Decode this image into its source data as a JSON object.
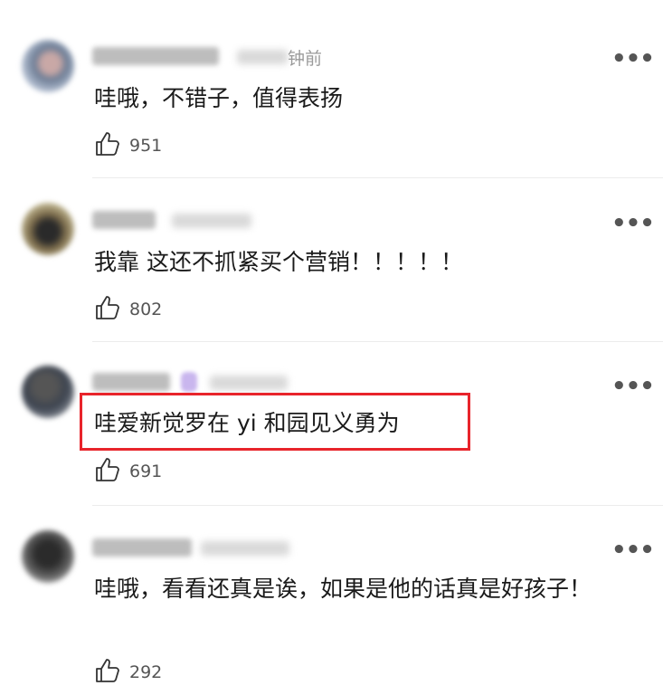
{
  "comments": [
    {
      "time_suffix": "钟前",
      "text": "哇哦，不错子，值得表扬",
      "like_count": "951",
      "more_label": "•••"
    },
    {
      "text": "我靠 这还不抓紧买个营销！！！！！",
      "like_count": "802",
      "more_label": "•••"
    },
    {
      "text": "哇爱新觉罗在 yi 和园见义勇为",
      "like_count": "691",
      "more_label": "•••"
    },
    {
      "text": "哇哦，看看还真是诶，如果是他的话真是好孩子！",
      "like_count": "292",
      "more_label": "•••"
    }
  ],
  "colors": {
    "highlight": "#e8242b",
    "text": "#1a1a1a",
    "meta": "#9a9a9a"
  },
  "icons": {
    "like": "thumbs-up-icon",
    "more": "more-dots-icon"
  }
}
